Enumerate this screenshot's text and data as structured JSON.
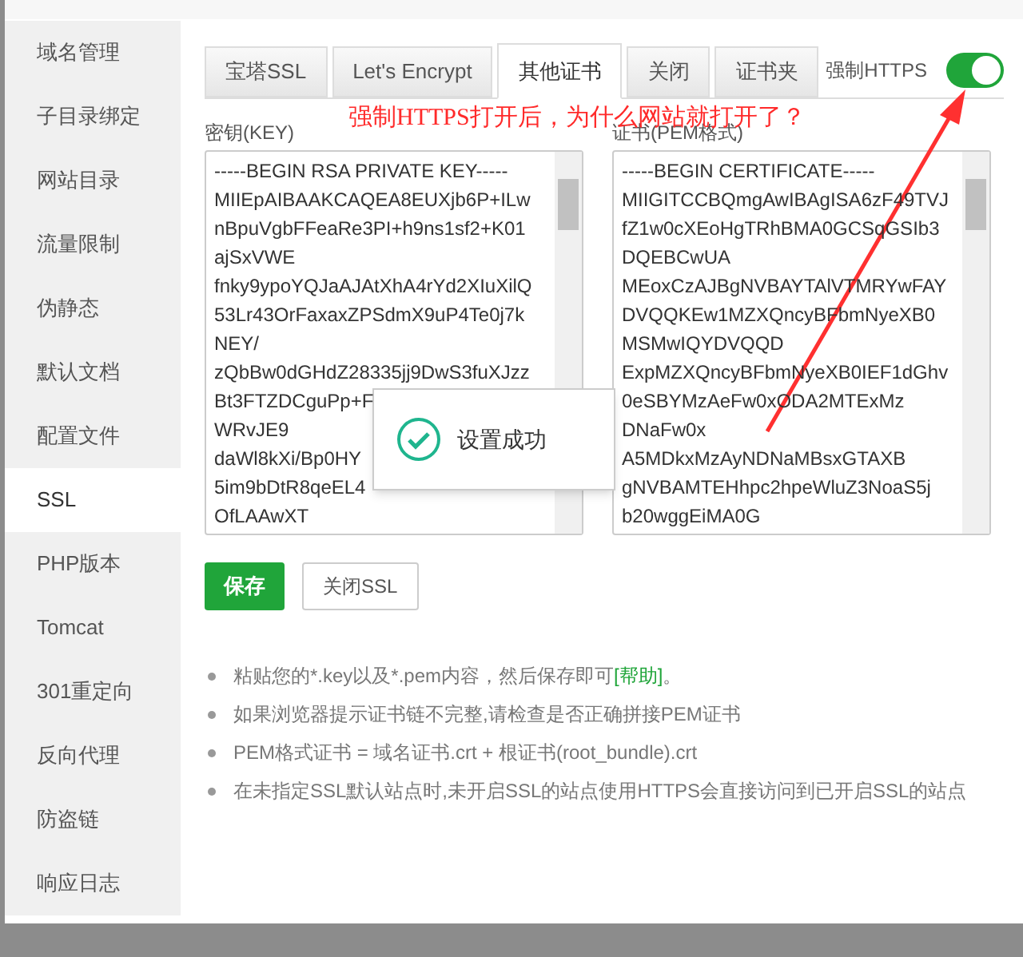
{
  "sidebar": {
    "items": [
      {
        "label": "域名管理",
        "selected": false
      },
      {
        "label": "子目录绑定",
        "selected": false
      },
      {
        "label": "网站目录",
        "selected": false
      },
      {
        "label": "流量限制",
        "selected": false
      },
      {
        "label": "伪静态",
        "selected": false
      },
      {
        "label": "默认文档",
        "selected": false
      },
      {
        "label": "配置文件",
        "selected": false
      },
      {
        "label": "SSL",
        "selected": true
      },
      {
        "label": "PHP版本",
        "selected": false
      },
      {
        "label": "Tomcat",
        "selected": false
      },
      {
        "label": "301重定向",
        "selected": false
      },
      {
        "label": "反向代理",
        "selected": false
      },
      {
        "label": "防盗链",
        "selected": false
      },
      {
        "label": "响应日志",
        "selected": false
      }
    ]
  },
  "tabs": [
    {
      "label": "宝塔SSL",
      "selected": false
    },
    {
      "label": "Let's Encrypt",
      "selected": false
    },
    {
      "label": "其他证书",
      "selected": true
    },
    {
      "label": "关闭",
      "selected": false
    },
    {
      "label": "证书夹",
      "selected": false
    }
  ],
  "force_https": {
    "label": "强制HTTPS",
    "on": true
  },
  "annotation": {
    "text": "强制HTTPS打开后，为什么网站就打开了？"
  },
  "key_field": {
    "label": "密钥(KEY)",
    "lines": [
      "-----BEGIN RSA PRIVATE KEY-----",
      "MIIEpAIBAAKCAQEA8EUXjb6P+ILw",
      "nBpuVgbFFeaRe3PI+h9ns1sf2+K01",
      "ajSxVWE",
      "fnky9ypoYQJaAJAtXhA4rYd2XIuXilQ",
      "53Lr43OrFaxaxZPSdmX9uP4Te0j7k",
      "NEY/",
      "zQbBw0dGHdZ28335jj9DwS3fuXJzz",
      "Bt3FTZDCguPp+F",
      "WRvJE9",
      "daWl8kXi/Bp0HY",
      "5im9bDtR8qeEL4",
      "OfLAAwXT"
    ]
  },
  "cert_field": {
    "label": "证书(PEM格式)",
    "lines": [
      "-----BEGIN CERTIFICATE-----",
      "MIIGITCCBQmgAwIBAgISA6zF49TVJ",
      "fZ1w0cXEoHgTRhBMA0GCSqGSIb3",
      "DQEBCwUA",
      "MEoxCzAJBgNVBAYTAlVTMRYwFAY",
      "DVQQKEw1MZXQncyBFbmNyeXB0",
      "MSMwIQYDVQQD",
      "ExpMZXQncyBFbmNyeXB0IEF1dGhv",
      "0eSBYMzAeFw0xODA2MTExMz",
      "DNaFw0x",
      "A5MDkxMzAyNDNaMBsxGTAXB",
      "gNVBAMTEHhpc2hpeWluZ3NoaS5j",
      "b20wggEiMA0G"
    ]
  },
  "buttons": [
    {
      "label": "保存",
      "kind": "primary"
    },
    {
      "label": "关闭SSL",
      "kind": "default"
    }
  ],
  "notes": [
    {
      "text": "粘贴您的*.key以及*.pem内容，然后保存即可",
      "link": "[帮助]",
      "after": "。"
    },
    {
      "text": "如果浏览器提示证书链不完整,请检查是否正确拼接PEM证书"
    },
    {
      "text": "PEM格式证书 = 域名证书.crt + 根证书(root_bundle).crt"
    },
    {
      "text": "在未指定SSL默认站点时,未开启SSL的站点使用HTTPS会直接访问到已开启SSL的站点"
    }
  ],
  "toast": {
    "text": "设置成功"
  }
}
